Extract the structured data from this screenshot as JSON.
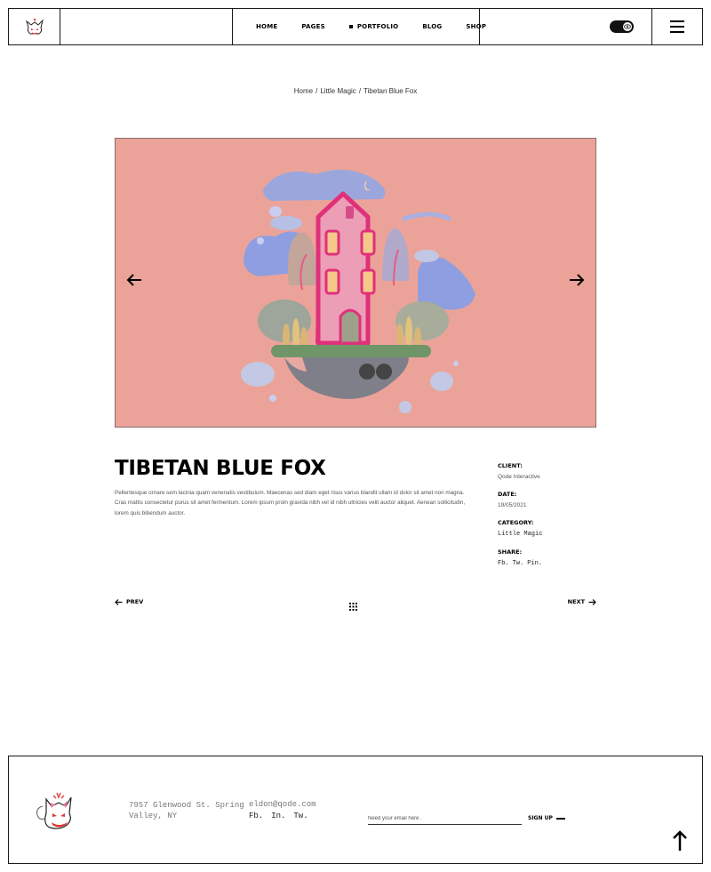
{
  "header": {
    "nav": [
      {
        "label": "HOME",
        "active": false
      },
      {
        "label": "PAGES",
        "active": false
      },
      {
        "label": "PORTFOLIO",
        "active": true
      },
      {
        "label": "BLOG",
        "active": false
      },
      {
        "label": "SHOP",
        "active": false
      }
    ],
    "icons": {
      "logo": "fox-logo-icon",
      "theme_toggle": "eye-toggle-icon",
      "menu": "hamburger-menu-icon"
    }
  },
  "breadcrumb": {
    "items": [
      "Home",
      "Little Magic",
      "Tibetan Blue Fox"
    ],
    "separator": "/"
  },
  "slider": {
    "background": "#eba399",
    "prev_icon": "arrow-left-icon",
    "next_icon": "arrow-right-icon"
  },
  "project": {
    "title": "TIBETAN BLUE FOX",
    "description": "Pellentesque ornare sem lacinia quam venenatis vestibulum. Maecenas sed diam eget risus varius blandit ullam id dolor sit amet non magna. Cras mattis consectetur purus sit amet fermentum. Lorem ipsum proin gravida nibh vel id nibh ultricies velit auctor aliquet. Aenean sollicitudin, lorem quis bibendum auctor.",
    "meta": {
      "client_label": "CLIENT:",
      "client": "Qode Interactive",
      "date_label": "DATE:",
      "date": "19/05/2021",
      "category_label": "CATEGORY:",
      "category": "Little Magic",
      "share_label": "SHARE:",
      "share": [
        "Fb.",
        "Tw.",
        "Pin."
      ]
    }
  },
  "pager": {
    "prev": "PREV",
    "next": "NEXT",
    "grid_icon": "grid-icon"
  },
  "footer": {
    "address": "7957 Glenwood St. Spring Valley, NY",
    "email": "eldon@qode.com",
    "social": [
      "Fb.",
      "In.",
      "Tw."
    ],
    "email_placeholder": "Need your email here .",
    "signup": "SIGN UP",
    "to_top_icon": "arrow-up-icon"
  }
}
